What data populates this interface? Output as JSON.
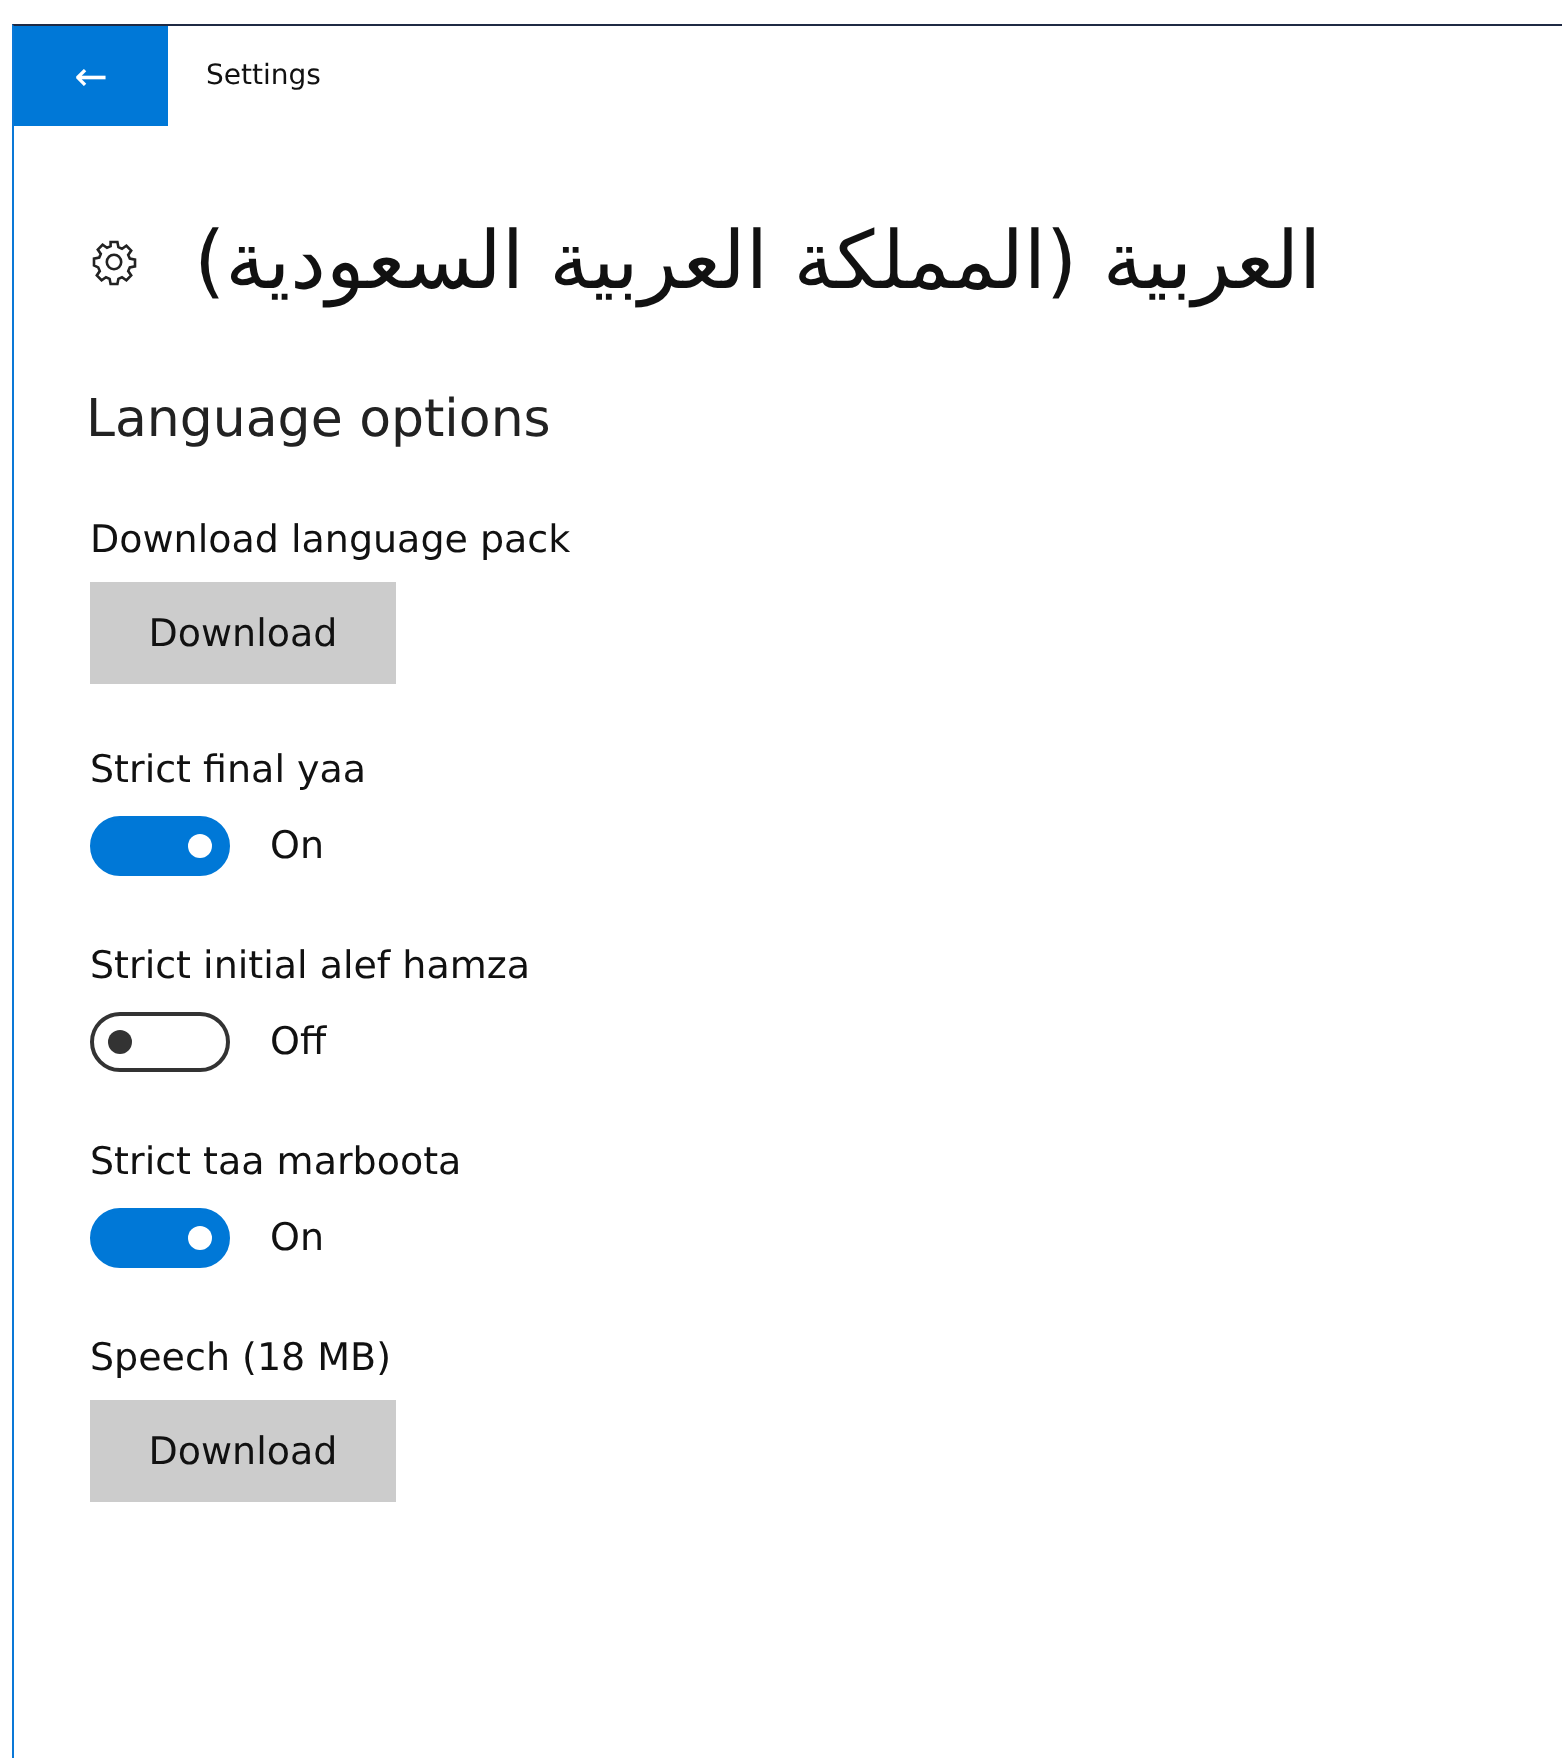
{
  "window": {
    "title": "Settings",
    "back": "←"
  },
  "heading": "العربية (المملكة العربية السعودية)",
  "section": "Language options",
  "items": [
    {
      "kind": "button",
      "label": "Download language pack",
      "button": "Download"
    },
    {
      "kind": "toggle",
      "label": "Strict final yaa",
      "on": true,
      "state": "On"
    },
    {
      "kind": "toggle",
      "label": "Strict initial alef hamza",
      "on": false,
      "state": "Off"
    },
    {
      "kind": "toggle",
      "label": "Strict taa marboota",
      "on": true,
      "state": "On"
    },
    {
      "kind": "button",
      "label": "Speech (18 MB)",
      "button": "Download"
    }
  ]
}
